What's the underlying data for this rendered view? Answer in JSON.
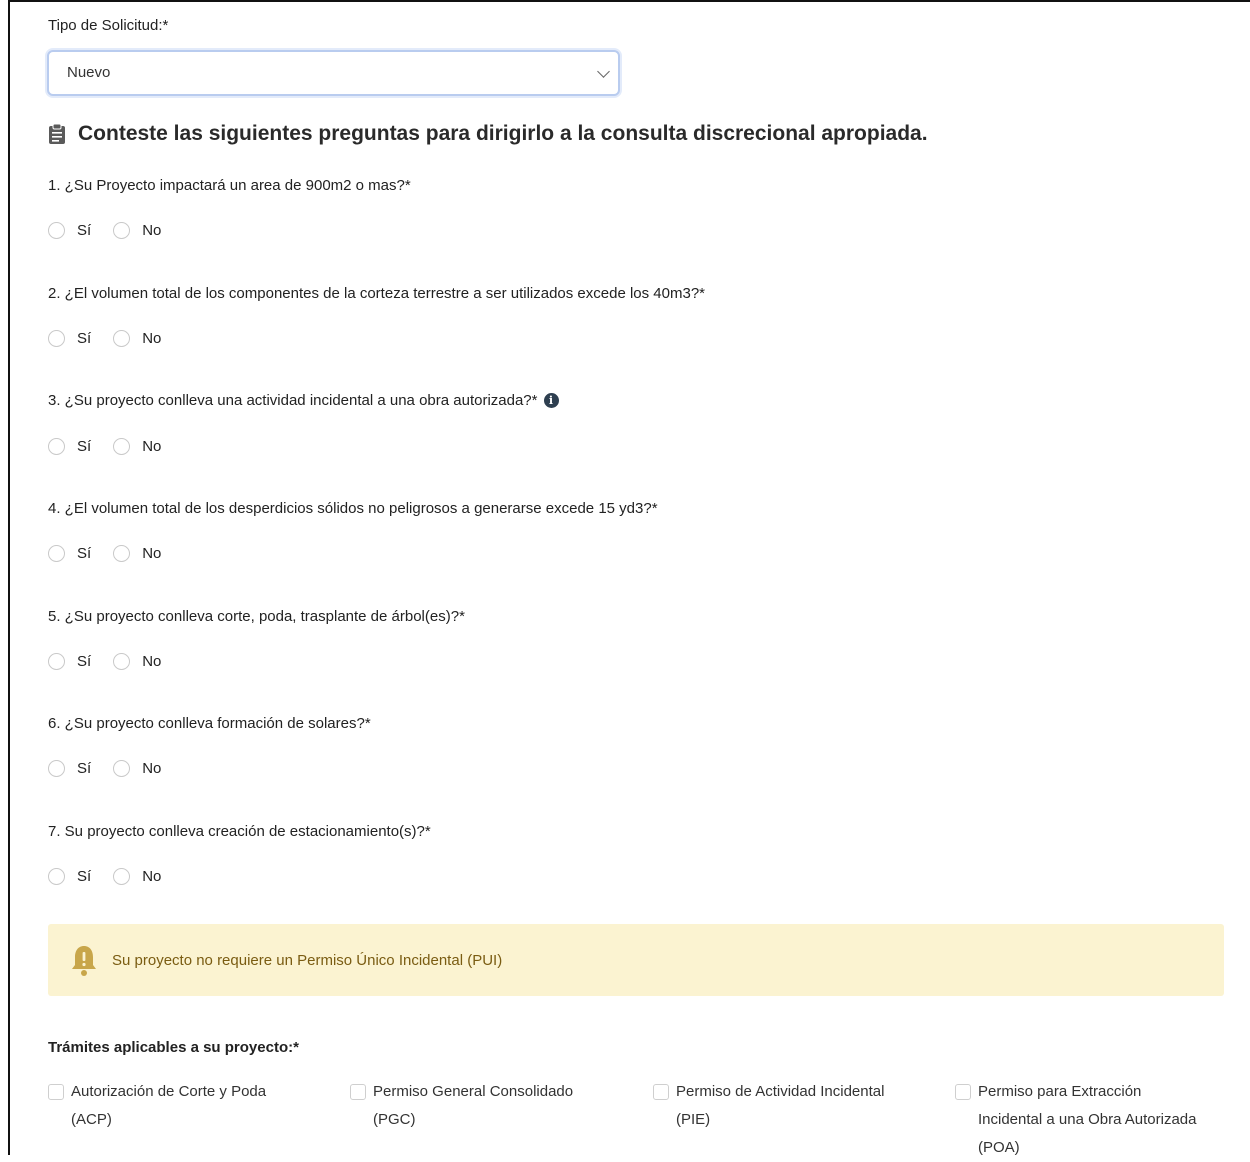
{
  "form": {
    "request_type_label": "Tipo de Solicitud:*",
    "request_type_value": "Nuevo"
  },
  "section_heading": "Conteste las siguientes preguntas para dirigirlo a la consulta discrecional apropiada.",
  "radio_labels": {
    "yes": "Sí",
    "no": "No"
  },
  "questions": [
    {
      "text": "1. ¿Su Proyecto impactará un area de 900m2 o mas?*"
    },
    {
      "text": "2. ¿El volumen total de los componentes de la corteza terrestre a ser utilizados excede los 40m3?*"
    },
    {
      "text": "3. ¿Su proyecto conlleva una actividad incidental a una obra autorizada?*",
      "info_icon": "info-icon"
    },
    {
      "text": "4. ¿El volumen total de los desperdicios sólidos no peligrosos a generarse excede 15 yd3?*"
    },
    {
      "text": "5. ¿Su proyecto conlleva corte, poda, trasplante de árbol(es)?*"
    },
    {
      "text": "6. ¿Su proyecto conlleva formación de solares?*"
    },
    {
      "text": "7. Su proyecto conlleva creación de estacionamiento(s)?*"
    }
  ],
  "alert": {
    "icon": "bell-warning-icon",
    "text": "Su proyecto no requiere un Permiso Único Incidental (PUI)"
  },
  "procedures": {
    "title": "Trámites aplicables a su proyecto:*",
    "items": [
      {
        "label": "Autorización de Corte y Poda (ACP)"
      },
      {
        "label": "Permiso General Consolidado (PGC)"
      },
      {
        "label": "Permiso de Actividad Incidental (PIE)"
      },
      {
        "label": "Permiso para Extracción Incidental a una Obra Autorizada (POA)"
      }
    ]
  },
  "colors": {
    "alert_background": "#fbf3d1",
    "alert_text": "#7a5c12",
    "select_focus_border": "#b9ccef",
    "info_icon": "#2e3f50"
  }
}
